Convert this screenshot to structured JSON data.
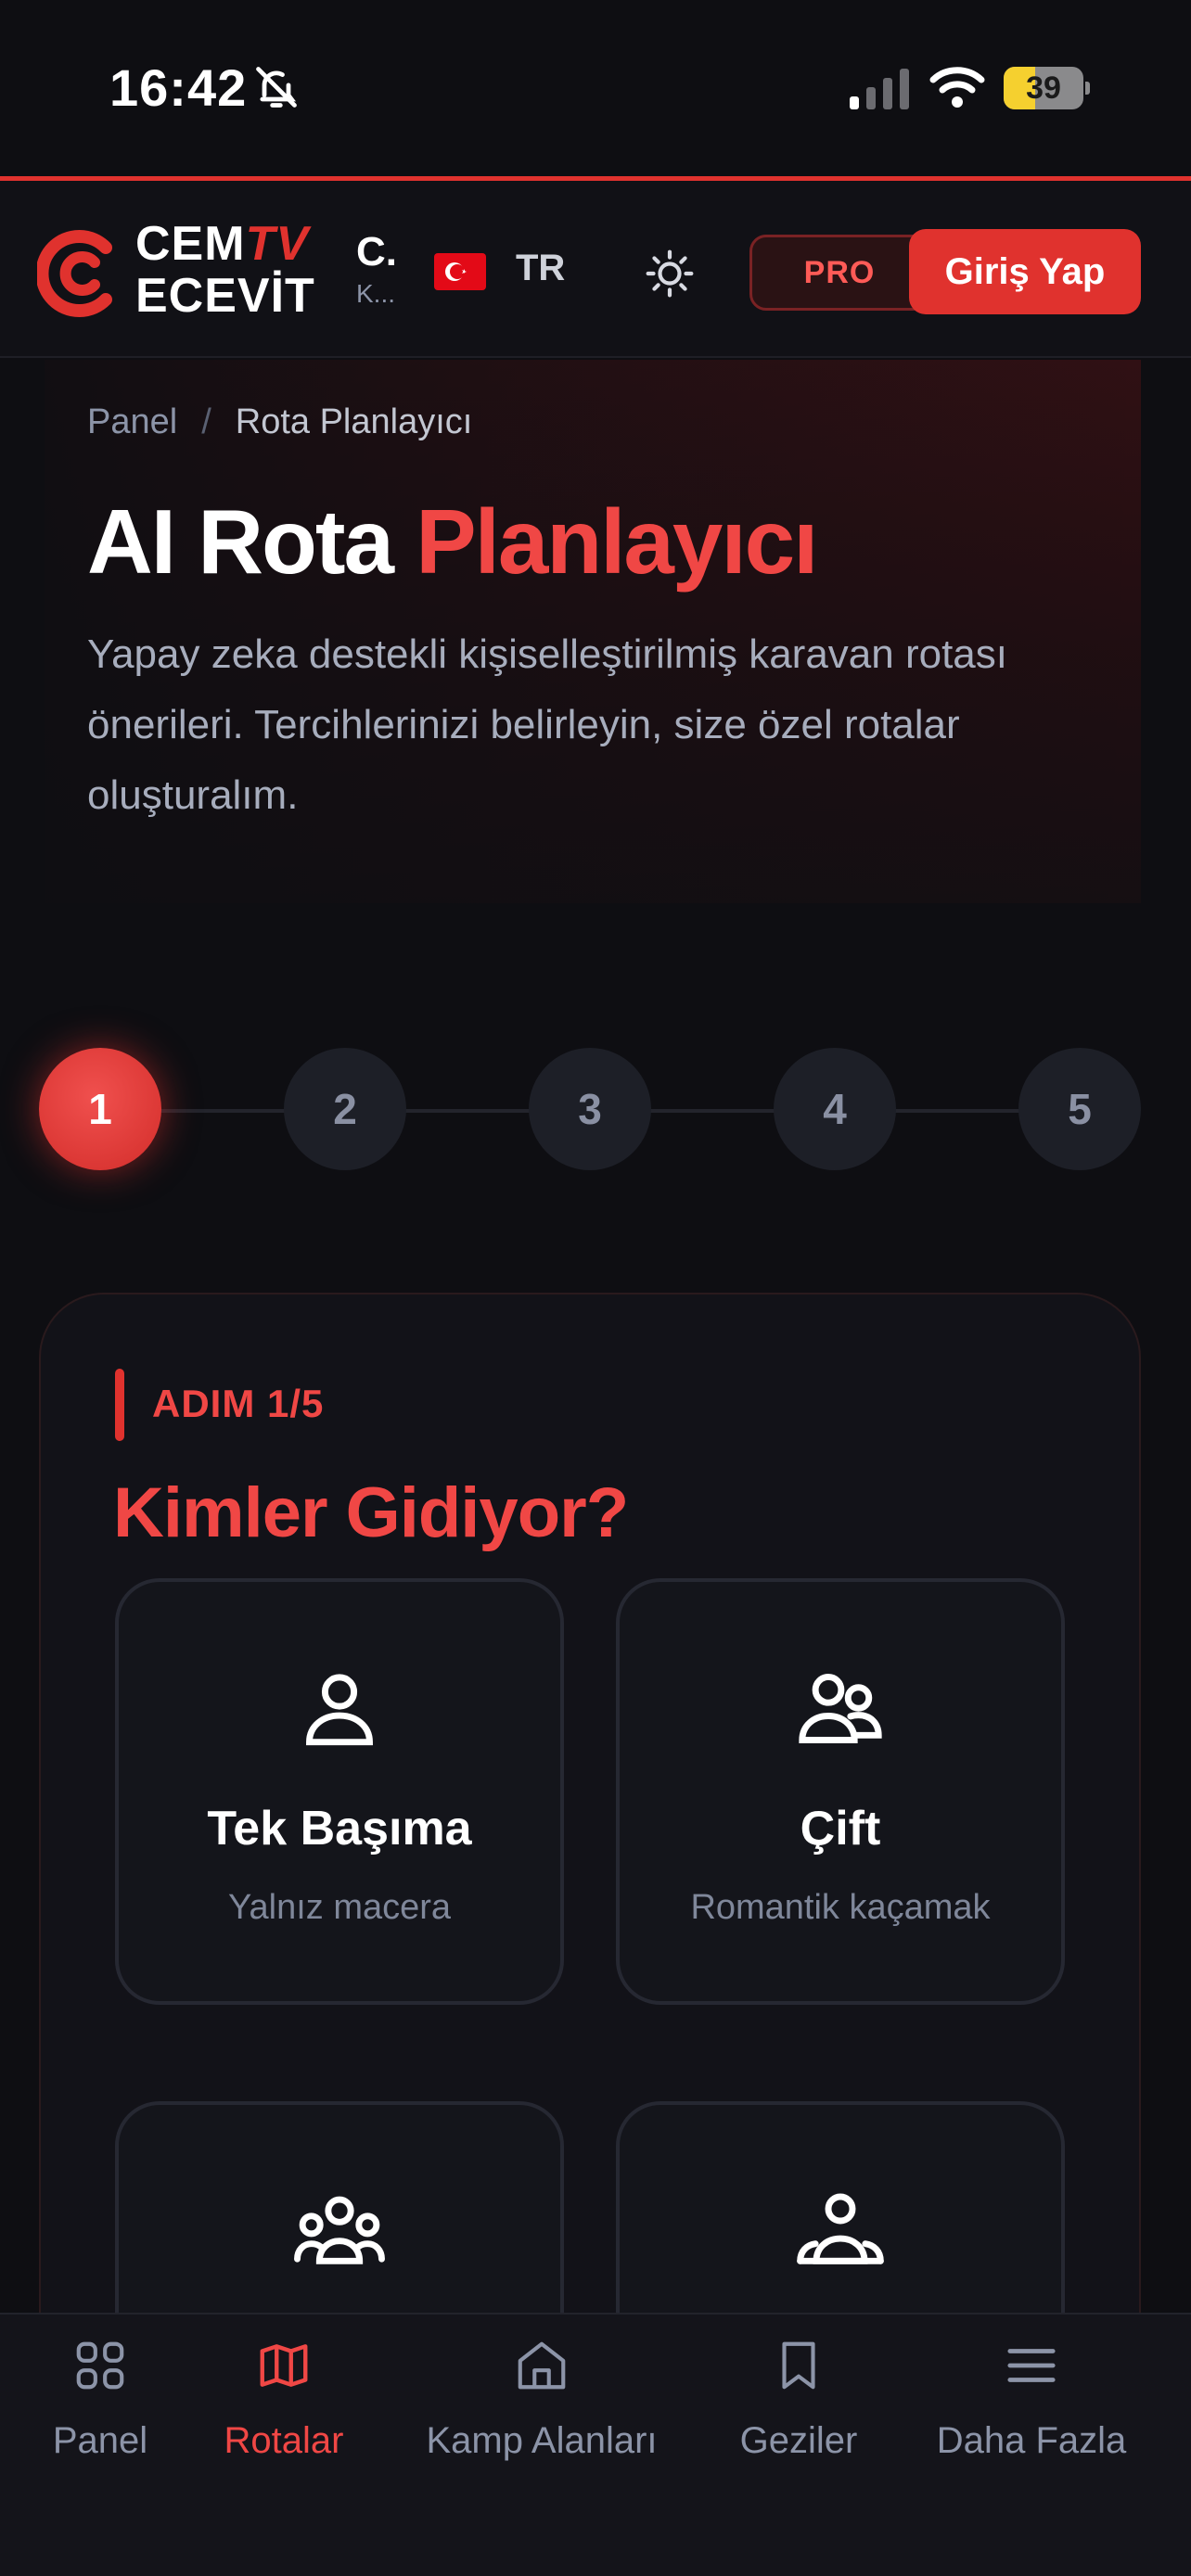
{
  "status_bar": {
    "time": "16:42",
    "battery": "39",
    "battery_level": 0.39
  },
  "header": {
    "logo_line1_a": "CEM",
    "logo_line1_b": "TV",
    "logo_line2": "ECEVİT",
    "site_short": "C.",
    "site_sub": "K...",
    "language": "TR",
    "pro_label": "PRO",
    "login_label": "Giriş Yap"
  },
  "breadcrumb": {
    "root": "Panel",
    "separator": "/",
    "current": "Rota Planlayıcı"
  },
  "hero": {
    "title_a": "AI Rota",
    "title_b": "Planlayıcı",
    "description": "Yapay zeka destekli kişiselleştirilmiş karavan rotası önerileri. Tercihlerinizi belirleyin, size özel rotalar oluşturalım."
  },
  "stepper": {
    "steps": [
      "1",
      "2",
      "3",
      "4",
      "5"
    ],
    "active": 1
  },
  "wizard": {
    "step_tag": "ADIM 1/5",
    "question": "Kimler Gidiyor?",
    "options": [
      {
        "title": "Tek Başıma",
        "subtitle": "Yalnız macera",
        "icon": "single-person-icon"
      },
      {
        "title": "Çift",
        "subtitle": "Romantik kaçamak",
        "icon": "couple-icon"
      },
      {
        "title": "",
        "subtitle": "",
        "icon": "group-icon"
      },
      {
        "title": "",
        "subtitle": "",
        "icon": "family-icon"
      }
    ]
  },
  "bottom_nav": [
    {
      "label": "Panel",
      "icon": "grid-icon"
    },
    {
      "label": "Rotalar",
      "icon": "map-icon",
      "active": true
    },
    {
      "label": "Kamp Alanları",
      "icon": "home-icon"
    },
    {
      "label": "Geziler",
      "icon": "bookmark-icon"
    },
    {
      "label": "Daha Fazla",
      "icon": "menu-icon"
    }
  ],
  "colors": {
    "accent": "#e0322e",
    "background": "#0e0e12",
    "muted": "#8c94a8"
  }
}
